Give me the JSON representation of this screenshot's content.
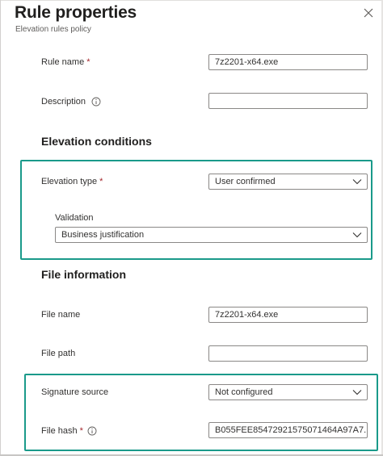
{
  "panel": {
    "title": "Rule properties",
    "subtitle": "Elevation rules policy",
    "close_icon": "close-icon"
  },
  "fields": {
    "rule_name": {
      "label": "Rule name",
      "required": "*",
      "value": "7z2201-x64.exe"
    },
    "description": {
      "label": "Description",
      "value": "",
      "info_icon": "info-icon"
    }
  },
  "elevation_conditions": {
    "heading": "Elevation conditions",
    "elevation_type": {
      "label": "Elevation type",
      "required": "*",
      "value": "User confirmed"
    },
    "validation": {
      "label": "Validation",
      "value": "Business justification"
    }
  },
  "file_information": {
    "heading": "File information",
    "file_name": {
      "label": "File name",
      "value": "7z2201-x64.exe"
    },
    "file_path": {
      "label": "File path",
      "value": ""
    },
    "signature_source": {
      "label": "Signature source",
      "value": "Not configured"
    },
    "file_hash": {
      "label": "File hash",
      "required": "*",
      "value": "B055FEE85472921575071464A97A7...",
      "info_icon": "info-icon"
    }
  },
  "colors": {
    "highlight": "#1a9a8a",
    "required": "#a4262c",
    "field_border": "#8a8886"
  }
}
